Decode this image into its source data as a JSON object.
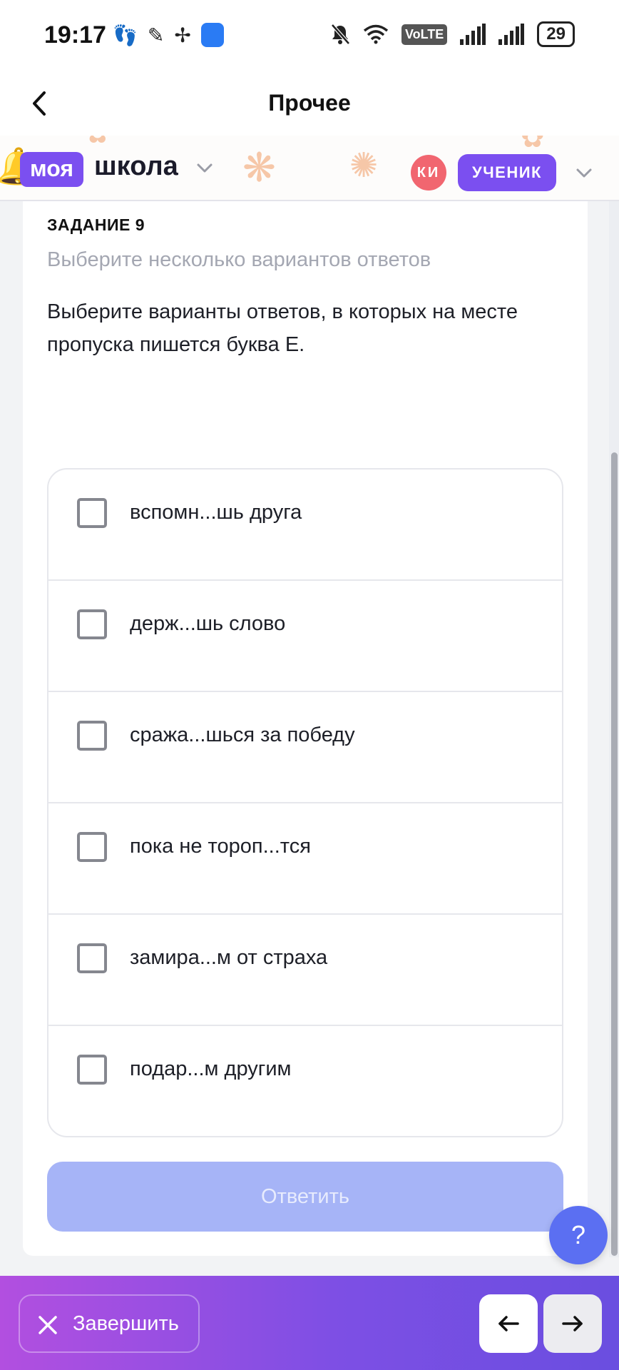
{
  "status_bar": {
    "time": "19:17",
    "volte": "VoLTE",
    "battery": "29",
    "icons": [
      "footprints-icon",
      "hummingbird-icon",
      "pinwheel-icon",
      "app-market-icon",
      "mute-icon",
      "wifi-icon",
      "signal-icon",
      "signal-icon",
      "battery-icon"
    ]
  },
  "app_bar": {
    "title": "Прочее",
    "back_icon": "chevron-left-icon"
  },
  "school_header": {
    "logo_part1": "моя",
    "logo_part2": "школа",
    "avatar_initials": "КИ",
    "role": "УЧЕНИК",
    "accent_color": "#7b4ff0",
    "avatar_color": "#f16670"
  },
  "task": {
    "number_label": "ЗАДАНИЕ 9",
    "hint": "Выберите несколько вариантов ответов",
    "question": "Выберите варианты ответов, в которых на месте пропуска пишется буква Е.",
    "options": [
      {
        "label": "вспомн...шь друга",
        "checked": false
      },
      {
        "label": "держ...шь слово",
        "checked": false
      },
      {
        "label": "сража...шься за победу",
        "checked": false
      },
      {
        "label": "пока не тороп...тся",
        "checked": false
      },
      {
        "label": "замира...м от страха",
        "checked": false
      },
      {
        "label": "подар...м другим",
        "checked": false
      }
    ],
    "answer_button": "Ответить"
  },
  "help_button": "?",
  "bottom_bar": {
    "finish_label": "Завершить",
    "prev_icon": "arrow-left-icon",
    "next_icon": "arrow-right-icon"
  }
}
